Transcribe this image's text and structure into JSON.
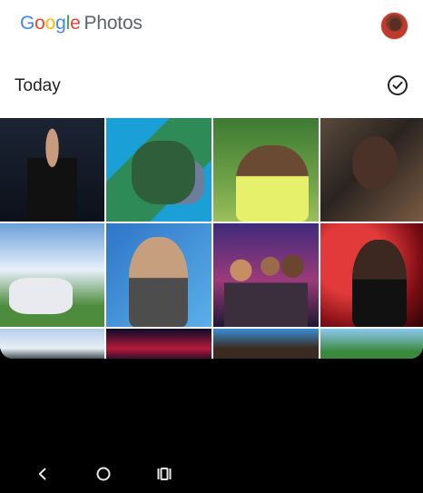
{
  "app": {
    "logo_parts": {
      "g1": "G",
      "g2": "o",
      "g3": "o",
      "g4": "g",
      "g5": "l",
      "g6": "e",
      "photos": "Photos"
    }
  },
  "section": {
    "title": "Today"
  },
  "photos": [
    {
      "name": "photo-1"
    },
    {
      "name": "photo-2"
    },
    {
      "name": "photo-3"
    },
    {
      "name": "photo-4"
    },
    {
      "name": "photo-5"
    },
    {
      "name": "photo-6"
    },
    {
      "name": "photo-7"
    },
    {
      "name": "photo-8"
    },
    {
      "name": "photo-9"
    },
    {
      "name": "photo-10"
    },
    {
      "name": "photo-11"
    },
    {
      "name": "photo-12"
    }
  ],
  "icons": {
    "select_all": "check-circle-icon",
    "back": "back-icon",
    "home": "home-icon",
    "recents": "recents-icon"
  },
  "colors": {
    "google_blue": "#4285F4",
    "google_red": "#EA4335",
    "google_yellow": "#FBBC05",
    "google_green": "#34A853",
    "text_gray": "#5f6368"
  }
}
